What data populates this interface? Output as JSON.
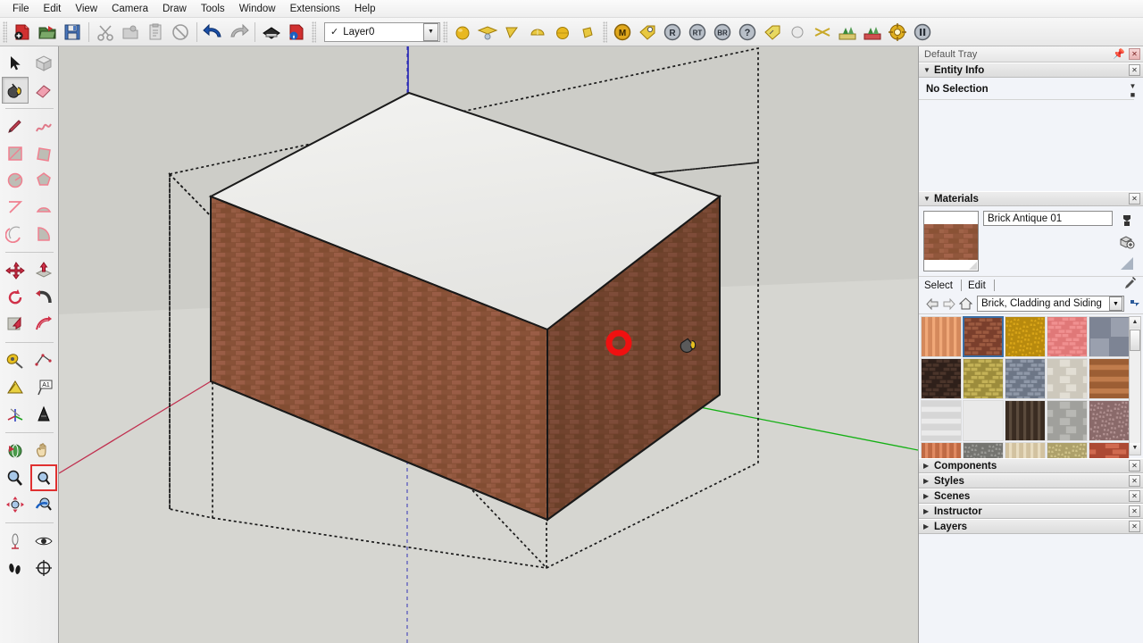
{
  "app": {
    "title": "SketchUp"
  },
  "menubar": {
    "items": [
      {
        "label": "File"
      },
      {
        "label": "Edit"
      },
      {
        "label": "View"
      },
      {
        "label": "Camera"
      },
      {
        "label": "Draw"
      },
      {
        "label": "Tools"
      },
      {
        "label": "Window"
      },
      {
        "label": "Extensions"
      },
      {
        "label": "Help"
      }
    ]
  },
  "toolbar": {
    "groups": [
      {
        "buttons": [
          {
            "icon": "new-document-icon",
            "tip": "New"
          },
          {
            "icon": "open-folder-icon",
            "tip": "Open"
          },
          {
            "icon": "save-floppy-icon",
            "tip": "Save"
          }
        ]
      },
      {
        "buttons": [
          {
            "icon": "cut-scissors-icon",
            "tip": "Cut"
          },
          {
            "icon": "copy-icon",
            "tip": "Copy"
          },
          {
            "icon": "paste-icon",
            "tip": "Paste"
          },
          {
            "icon": "erase-circle-icon",
            "tip": "Erase"
          }
        ]
      },
      {
        "buttons": [
          {
            "icon": "undo-arrow-icon",
            "tip": "Undo"
          },
          {
            "icon": "redo-arrow-icon",
            "tip": "Redo"
          }
        ]
      },
      {
        "buttons": [
          {
            "icon": "print-icon",
            "tip": "Print"
          },
          {
            "icon": "model-info-icon",
            "tip": "Model Info"
          }
        ]
      }
    ],
    "layer": {
      "check": "✓",
      "name": "Layer0",
      "arrow": "▼"
    },
    "render_buttons": [
      {
        "icon": "sphere-gold-icon",
        "tip": "Render"
      },
      {
        "icon": "material-preview-icon",
        "tip": "Material Preview"
      },
      {
        "icon": "light-cone-icon",
        "tip": "Lights"
      },
      {
        "icon": "dome-icon",
        "tip": "Dome Light"
      },
      {
        "icon": "sphere-light-icon",
        "tip": "Sphere Light"
      },
      {
        "icon": "spot-light-icon",
        "tip": "Spot Light"
      }
    ],
    "badge_buttons": [
      {
        "icon": "m-badge-icon",
        "label": "M"
      },
      {
        "icon": "tag-gold-icon",
        "label": ""
      },
      {
        "icon": "r-badge-icon",
        "label": "R"
      },
      {
        "icon": "rt-badge-icon",
        "label": "RT"
      },
      {
        "icon": "br-badge-icon",
        "label": "BR"
      },
      {
        "icon": "help-badge-icon",
        "label": "?"
      },
      {
        "icon": "tag-yellow-icon",
        "label": ""
      },
      {
        "icon": "sphere-white-icon",
        "label": ""
      },
      {
        "icon": "crossed-tools-icon",
        "label": ""
      },
      {
        "icon": "scene-trees-icon",
        "label": ""
      },
      {
        "icon": "scene-trees-red-icon",
        "label": ""
      },
      {
        "icon": "target-gold-icon",
        "label": ""
      },
      {
        "icon": "pause-badge-icon",
        "label": ""
      }
    ]
  },
  "left_toolbar": {
    "rows": [
      [
        {
          "icon": "select-arrow-icon",
          "active": false
        },
        {
          "icon": "make-component-icon",
          "active": false
        }
      ],
      [
        {
          "icon": "paint-bucket-icon",
          "active": true
        },
        {
          "icon": "eraser-icon",
          "active": false
        }
      ],
      [
        {
          "icon": "line-pencil-icon",
          "active": false
        },
        {
          "icon": "freehand-icon",
          "active": false
        }
      ],
      [
        {
          "icon": "rectangle-icon",
          "active": false
        },
        {
          "icon": "rotated-rectangle-icon",
          "active": false
        }
      ],
      [
        {
          "icon": "circle-icon",
          "active": false
        },
        {
          "icon": "polygon-icon",
          "active": false
        }
      ],
      [
        {
          "icon": "arc-icon",
          "active": false
        },
        {
          "icon": "two-point-arc-icon",
          "active": false
        }
      ],
      [
        {
          "icon": "three-point-arc-icon",
          "active": false
        },
        {
          "icon": "pie-icon",
          "active": false
        }
      ],
      [
        {
          "icon": "move-icon",
          "active": false
        },
        {
          "icon": "push-pull-icon",
          "active": false
        }
      ],
      [
        {
          "icon": "rotate-icon",
          "active": false
        },
        {
          "icon": "follow-me-icon",
          "active": false
        }
      ],
      [
        {
          "icon": "scale-icon",
          "active": false
        },
        {
          "icon": "offset-icon",
          "active": false
        }
      ],
      [
        {
          "icon": "tape-measure-icon",
          "active": false
        },
        {
          "icon": "dimension-icon",
          "active": false
        }
      ],
      [
        {
          "icon": "protractor-icon",
          "active": false
        },
        {
          "icon": "text-label-icon",
          "active": false
        }
      ],
      [
        {
          "icon": "axes-icon",
          "active": false
        },
        {
          "icon": "three-d-text-icon",
          "active": false
        }
      ],
      [
        {
          "icon": "orbit-icon",
          "active": false
        },
        {
          "icon": "pan-hand-icon",
          "active": false
        }
      ],
      [
        {
          "icon": "zoom-icon",
          "active": false
        },
        {
          "icon": "zoom-window-icon",
          "active_red": true
        }
      ],
      [
        {
          "icon": "zoom-extents-icon",
          "active": false
        },
        {
          "icon": "previous-view-icon",
          "active": false
        }
      ],
      [
        {
          "icon": "position-camera-icon",
          "active": false
        },
        {
          "icon": "look-around-icon",
          "active": false
        }
      ],
      [
        {
          "icon": "walk-icon",
          "active": false
        },
        {
          "icon": "section-plane-icon",
          "active": false
        }
      ]
    ]
  },
  "viewport": {
    "background_color": "#cdcdc8",
    "ground_color": "#d7d7d2",
    "axis_red": "#c0304f",
    "axis_green": "#14b014",
    "axis_blue": "#2020b4",
    "model": {
      "name": "brick-box",
      "top_face_color": "#ececec",
      "front_face_texture": "brick",
      "side_face_texture": "brick",
      "edge_color": "#1a1a1a",
      "selection_box": "dashed"
    },
    "cursor": {
      "marker": "red-ring-marker",
      "marker_color": "#f01010",
      "tool": "paint-bucket-cursor"
    }
  },
  "tray": {
    "title": "Default Tray",
    "pin_icon": "pin-icon",
    "close_icon": "close-icon",
    "panels": [
      {
        "name": "Entity Info",
        "expanded": true,
        "content": {
          "status": "No Selection"
        }
      },
      {
        "name": "Materials",
        "expanded": true
      },
      {
        "name": "Components",
        "expanded": false
      },
      {
        "name": "Styles",
        "expanded": false
      },
      {
        "name": "Scenes",
        "expanded": false
      },
      {
        "name": "Instructor",
        "expanded": false
      },
      {
        "name": "Layers",
        "expanded": false
      }
    ]
  },
  "materials": {
    "current_name": "Brick Antique 01",
    "thumbnail_icon": "brick-thumbnail",
    "side_buttons": [
      {
        "icon": "create-material-icon"
      },
      {
        "icon": "sample-paint-icon"
      },
      {
        "icon": "default-material-icon"
      }
    ],
    "tabs": [
      {
        "label": "Select",
        "selected": true
      },
      {
        "label": "Edit",
        "selected": false
      }
    ],
    "eyedropper_icon": "eyedropper-icon",
    "nav": {
      "back_icon": "back-arrow-icon",
      "forward_icon": "forward-arrow-icon",
      "home_icon": "home-icon",
      "details_icon": "details-arrow-icon"
    },
    "category": "Brick, Cladding and Siding",
    "category_arrow": "▼",
    "scrollbar": {
      "up": "▲",
      "down": "▼"
    },
    "swatches": [
      {
        "name": "Wood Siding Light",
        "pattern": "vsiding",
        "c1": "#f0a878",
        "c2": "#d4895c",
        "selected": false
      },
      {
        "name": "Brick Antique 01",
        "pattern": "brick",
        "c1": "#9c5a40",
        "c2": "#7a3f2c",
        "selected": true
      },
      {
        "name": "Brick Rough Tan",
        "pattern": "rough",
        "c1": "#d9a518",
        "c2": "#b88a0e",
        "selected": false
      },
      {
        "name": "Brick Pink",
        "pattern": "brick",
        "c1": "#f09090",
        "c2": "#e07878",
        "selected": false
      },
      {
        "name": "Stone Blue Grey",
        "pattern": "stoneblock",
        "c1": "#9aa0ae",
        "c2": "#7d8494",
        "selected": false
      },
      {
        "name": "Brick Dark",
        "pattern": "brick",
        "c1": "#4a342a",
        "c2": "#2f201a",
        "selected": false
      },
      {
        "name": "Brick Olive",
        "pattern": "brick",
        "c1": "#c4b257",
        "c2": "#9c8c3c",
        "selected": false
      },
      {
        "name": "Brick Grey Blue",
        "pattern": "brick",
        "c1": "#8f98a8",
        "c2": "#6d7686",
        "selected": false
      },
      {
        "name": "Block Cream",
        "pattern": "block",
        "c1": "#e2ded4",
        "c2": "#cdc8bc",
        "selected": false
      },
      {
        "name": "Siding Brown",
        "pattern": "hsiding",
        "c1": "#c07c4c",
        "c2": "#9c5e34",
        "selected": false
      },
      {
        "name": "Siding White",
        "pattern": "hsiding",
        "c1": "#eaeaea",
        "c2": "#d6d6d6",
        "selected": false
      },
      {
        "name": "Plaster White",
        "pattern": "plain",
        "c1": "#e9e9e9",
        "c2": "#dedede",
        "selected": false
      },
      {
        "name": "Wood Dark Vertical",
        "pattern": "vsiding",
        "c1": "#5a4a3c",
        "c2": "#3a2c22",
        "selected": false
      },
      {
        "name": "Block Grey",
        "pattern": "block",
        "c1": "#b8b8b4",
        "c2": "#a0a09c",
        "selected": false
      },
      {
        "name": "Stone Red Speckle",
        "pattern": "speckle",
        "c1": "#b09090",
        "c2": "#8a6a6a",
        "selected": false
      },
      {
        "name": "Siding Salmon",
        "pattern": "vsiding",
        "c1": "#e08a62",
        "c2": "#c06a44",
        "selected": false
      },
      {
        "name": "Stone Grey Dark",
        "pattern": "speckle",
        "c1": "#9a9a96",
        "c2": "#747470",
        "selected": false
      },
      {
        "name": "Wood Pale Vertical",
        "pattern": "vsiding",
        "c1": "#e8dcc0",
        "c2": "#d2c2a0",
        "selected": false
      },
      {
        "name": "Stone Tan Rough",
        "pattern": "rough",
        "c1": "#cfc28a",
        "c2": "#ada06a",
        "selected": false
      },
      {
        "name": "Brick Red Long",
        "pattern": "longbrick",
        "c1": "#d06a50",
        "c2": "#ac4a34",
        "selected": false
      }
    ]
  }
}
